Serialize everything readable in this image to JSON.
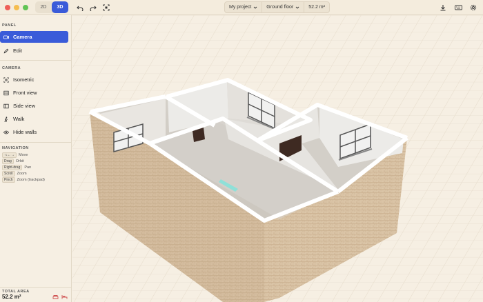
{
  "toolbar": {
    "view_2d": "2D",
    "view_3d": "3D",
    "project_name": "My project",
    "floor_name": "Ground floor",
    "area": "52.2 m²"
  },
  "panel": {
    "label": "PANEL",
    "items": [
      {
        "label": "Camera",
        "icon": "camera-icon",
        "active": true
      },
      {
        "label": "Edit",
        "icon": "pencil-icon",
        "active": false
      }
    ]
  },
  "camera": {
    "label": "CAMERA",
    "items": [
      {
        "label": "Isometric",
        "icon": "isometric-icon"
      },
      {
        "label": "Front view",
        "icon": "front-view-icon"
      },
      {
        "label": "Side view",
        "icon": "side-view-icon"
      },
      {
        "label": "Walk",
        "icon": "walk-icon"
      },
      {
        "label": "Hide walls",
        "icon": "eye-icon"
      }
    ]
  },
  "navigation": {
    "label": "NAVIGATION",
    "items": [
      {
        "key": "↑↓←→",
        "desc": "Move"
      },
      {
        "key": "Drag",
        "desc": "Orbit"
      },
      {
        "key": "Right-drag",
        "desc": "Pan"
      },
      {
        "key": "Scroll",
        "desc": "Zoom"
      },
      {
        "key": "Pinch",
        "desc": "Zoom (trackpad)"
      }
    ]
  },
  "total": {
    "label": "TOTAL AREA",
    "value": "52.2 m²"
  },
  "colors": {
    "accent": "#3a5bd9",
    "close": "#ee5f57",
    "minimize": "#f5bd4f",
    "zoom": "#61c454"
  }
}
